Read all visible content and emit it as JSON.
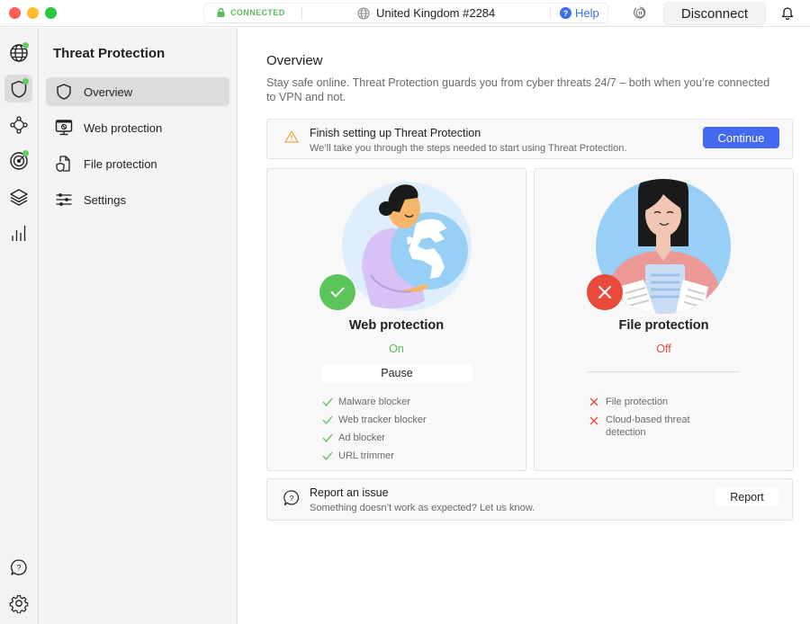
{
  "titlebar": {
    "connection_status": "CONNECTED",
    "server": "United Kingdom #2284",
    "help_label": "Help",
    "help_glyph": "?",
    "disconnect_label": "Disconnect",
    "icons": [
      "lock-icon",
      "globe-icon",
      "help-icon",
      "pause-icon",
      "bell-icon"
    ]
  },
  "rail": {
    "items": [
      {
        "name": "vpn",
        "icon": "globe-icon",
        "status_dot": true,
        "active": false
      },
      {
        "name": "threat-protection",
        "icon": "shield-icon",
        "status_dot": true,
        "active": true
      },
      {
        "name": "meshnet",
        "icon": "meshnet-icon",
        "status_dot": false,
        "active": false
      },
      {
        "name": "dark-web-monitor",
        "icon": "radar-icon",
        "status_dot": true,
        "active": false
      },
      {
        "name": "layers",
        "icon": "layers-icon",
        "status_dot": false,
        "active": false
      },
      {
        "name": "stats",
        "icon": "bar-chart-icon",
        "status_dot": false,
        "active": false
      }
    ],
    "bottom_items": [
      {
        "name": "help",
        "icon": "help-bubble-icon"
      },
      {
        "name": "settings",
        "icon": "gear-icon"
      }
    ]
  },
  "sidebar": {
    "title": "Threat Protection",
    "items": [
      {
        "label": "Overview",
        "icon": "shield-icon",
        "active": true
      },
      {
        "label": "Web protection",
        "icon": "monitor-block-icon",
        "active": false
      },
      {
        "label": "File protection",
        "icon": "file-shield-icon",
        "active": false
      },
      {
        "label": "Settings",
        "icon": "sliders-icon",
        "active": false
      }
    ]
  },
  "main": {
    "title": "Overview",
    "description": "Stay safe online. Threat Protection guards you from cyber threats 24/7 – both when you’re connected to VPN and not.",
    "banner": {
      "title": "Finish setting up Threat Protection",
      "subtitle": "We’ll take you through the steps needed to start using Threat Protection.",
      "button_label": "Continue"
    },
    "cards": {
      "web": {
        "title": "Web protection",
        "status": "On",
        "button_label": "Pause",
        "features": [
          "Malware blocker",
          "Web tracker blocker",
          "Ad blocker",
          "URL trimmer"
        ]
      },
      "file": {
        "title": "File protection",
        "status": "Off",
        "features": [
          "File protection",
          "Cloud-based threat detection"
        ]
      }
    },
    "report": {
      "title": "Report an issue",
      "subtitle": "Something doesn’t work as expected? Let us know.",
      "button_label": "Report"
    }
  },
  "colors": {
    "accent": "#4269ef",
    "success": "#5cbd5a",
    "danger": "#e84b3c",
    "warning": "#f0a040"
  }
}
